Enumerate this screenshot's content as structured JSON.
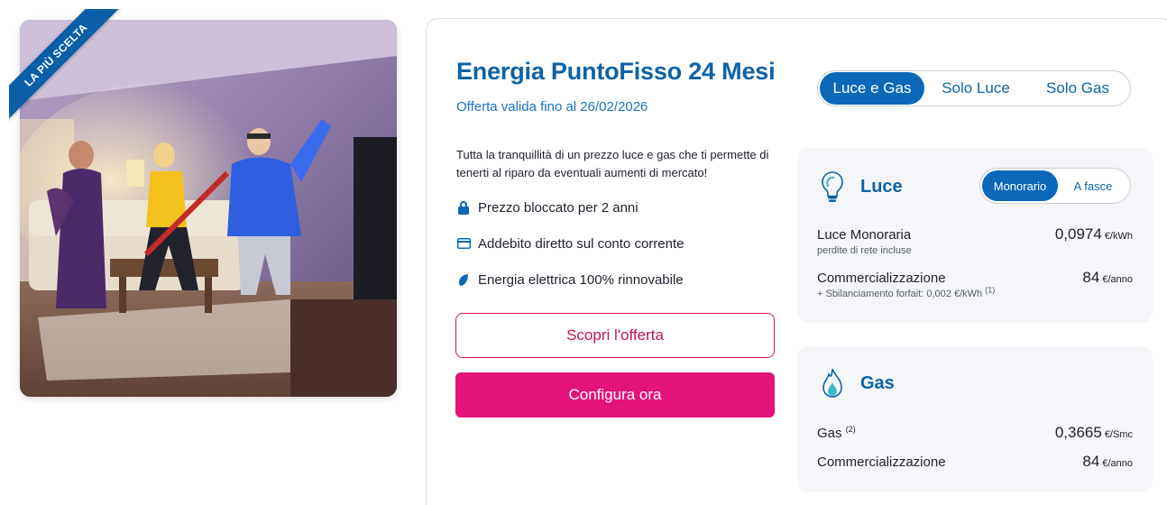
{
  "badge": {
    "label": "LA PIÙ SCELTA"
  },
  "offer": {
    "title": "Energia PuntoFisso 24 Mesi",
    "validity": "Offerta valida fino al 26/02/2026",
    "description": "Tutta la tranquillità di un prezzo luce e gas che ti permette di tenerti al riparo da eventuali aumenti di mercato!",
    "features": [
      {
        "icon": "lock-icon",
        "label": "Prezzo bloccato per 2 anni"
      },
      {
        "icon": "card-icon",
        "label": "Addebito diretto sul conto corrente"
      },
      {
        "icon": "leaf-icon",
        "label": "Energia elettrica 100% rinnovabile"
      }
    ],
    "cta_secondary": "Scopri l'offerta",
    "cta_primary": "Configura ora"
  },
  "supply_tabs": {
    "options": [
      "Luce e Gas",
      "Solo Luce",
      "Solo Gas"
    ],
    "selected": "Luce e Gas"
  },
  "luce": {
    "title": "Luce",
    "icon": "lightbulb-icon",
    "tariff_toggle": {
      "options": [
        "Monorario",
        "A fasce"
      ],
      "selected": "Monorario"
    },
    "rows": [
      {
        "label": "Luce Monoraria",
        "sub": "perdite di rete incluse",
        "value": "0,0974",
        "unit": "€/kWh"
      },
      {
        "label": "Commercializzazione",
        "sub": "+ Sbilanciamento forfait: 0,002 €/kWh",
        "sub_note": "(1)",
        "value": "84",
        "unit": "€/anno"
      }
    ]
  },
  "gas": {
    "title": "Gas",
    "icon": "flame-icon",
    "rows": [
      {
        "label": "Gas",
        "note": "(2)",
        "value": "0,3665",
        "unit": "€/Smc"
      },
      {
        "label": "Commercializzazione",
        "value": "84",
        "unit": "€/anno"
      }
    ]
  },
  "colors": {
    "brand_blue": "#0b67b8",
    "title_blue": "#0d63a6",
    "brand_pink": "#e4137a",
    "panel_bg": "#f5f6f9"
  }
}
